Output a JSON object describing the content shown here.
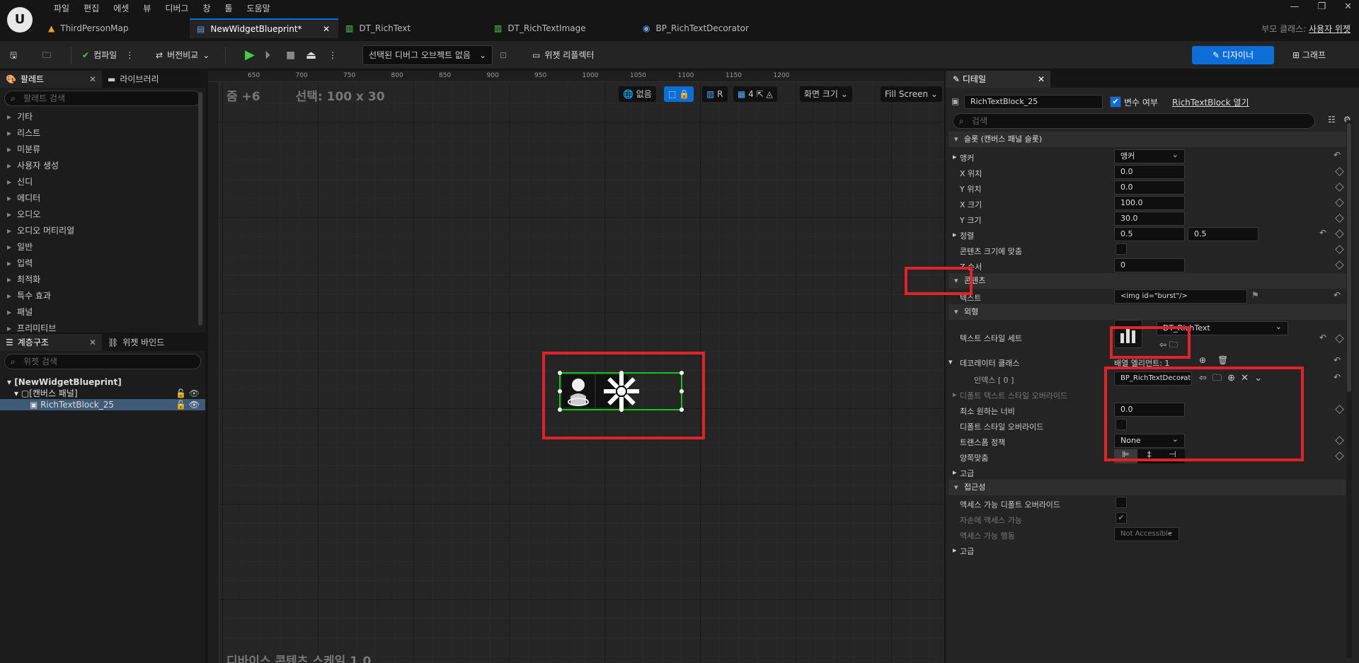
{
  "menu": [
    "파일",
    "편집",
    "에셋",
    "뷰",
    "디버그",
    "창",
    "툴",
    "도움말"
  ],
  "tabs": [
    {
      "label": "ThirdPersonMap",
      "active": false
    },
    {
      "label": "NewWidgetBlueprint*",
      "active": true
    },
    {
      "label": "DT_RichText",
      "active": false
    },
    {
      "label": "DT_RichTextImage",
      "active": false
    },
    {
      "label": "BP_RichTextDecorator",
      "active": false
    }
  ],
  "parent_class": {
    "label": "부모 클래스:",
    "value": "사용자 위젯"
  },
  "toolbar": {
    "compile": "컴파일",
    "diff": "버전비교",
    "debug_select": "선택된 디버그 오브젝트 없음",
    "widget_reflector": "위젯 리플렉터",
    "designer": "디자이너",
    "graph": "그래프"
  },
  "palette": {
    "tab": "팔레트",
    "library_tab": "라이브러리",
    "search_placeholder": "팔레트 검색",
    "categories": [
      "기타",
      "리스트",
      "미분류",
      "사용자 생성",
      "신디",
      "에디터",
      "오디오",
      "오디오 머티리얼",
      "일반",
      "입력",
      "최적화",
      "특수 효과",
      "패널",
      "프리미티브"
    ]
  },
  "hierarchy": {
    "tab": "계층구조",
    "bindings_tab": "위젯 바인드",
    "search_placeholder": "위젯 검색",
    "root": "[NewWidgetBlueprint]",
    "canvas": "[캔버스 패널]",
    "item": "RichTextBlock_25"
  },
  "viewport": {
    "zoom": "줌 +6",
    "selection": "선택: 100 x 30",
    "none": "없음",
    "r": "R",
    "grid": "4",
    "screen_size": "화면 크기",
    "fill_screen": "Fill Screen",
    "bottom": "디바이스 콘텐츠 스케일 1.0",
    "ruler_top": [
      "650",
      "700",
      "750",
      "800",
      "850",
      "900",
      "950",
      "1000",
      "1050",
      "1100",
      "1150",
      "1200"
    ]
  },
  "details": {
    "tab": "디테일",
    "name": "RichTextBlock_25",
    "is_variable": "변수 여부",
    "open_link": "RichTextBlock 열기",
    "search": "검색",
    "slot_section": "슬롯 (캔버스 패널 슬롯)",
    "anchor_label": "앵커",
    "anchor_value": "앵커",
    "x_pos": "X 위치",
    "x_pos_v": "0.0",
    "y_pos": "Y 위치",
    "y_pos_v": "0.0",
    "x_size": "X 크기",
    "x_size_v": "100.0",
    "y_size": "Y 크기",
    "y_size_v": "30.0",
    "align": "정렬",
    "align_v1": "0.5",
    "align_v2": "0.5",
    "size_to_content": "콘텐츠 크기에 맞춤",
    "z_order": "Z 순서",
    "z_order_v": "0",
    "content_section": "콘텐츠",
    "text_label": "텍스트",
    "text_value": "<img id=\"burst\"/>",
    "appearance_section": "외형",
    "text_style_set": "텍스트 스타일 세트",
    "style_asset": "DT_RichText",
    "decorator_classes": "데코레이터 클래스",
    "array_elements": "배열 엘리먼트: 1",
    "index0": "인덱스 [ 0 ]",
    "decorator_value": "BP_RichTextDecorat",
    "default_text_style_override": "디폴트 텍스트 스타일 오버라이드",
    "min_desired_width": "최소 원하는 너비",
    "min_desired_width_v": "0.0",
    "default_style_override": "디폴트 스타일 오버라이드",
    "transform_policy": "트랜스폼 정책",
    "transform_policy_v": "None",
    "justification": "양쪽맞춤",
    "advanced": "고급",
    "accessibility_section": "접근성",
    "override_access": "액세스 가능 디폴트 오버라이드",
    "children_access": "자손에 액세스 가능",
    "access_behavior": "액세스 가능 행동",
    "access_behavior_v": "Not Accessible",
    "advanced2": "고급"
  },
  "colors": {
    "accent": "#0e6ed8",
    "highlight": "#e0232a",
    "selection": "#18c418"
  }
}
